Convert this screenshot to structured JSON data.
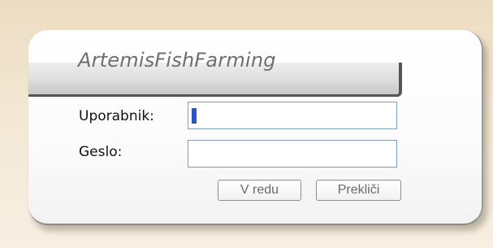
{
  "login": {
    "title": "ArtemisFishFarming",
    "username_label": "Uporabnik:",
    "username_value": "",
    "password_label": "Geslo:",
    "password_value": "",
    "ok_label": "V redu",
    "cancel_label": "Prekliči"
  },
  "colors": {
    "background": "#ecdcc1",
    "panel": "#ffffff",
    "input_border": "#7f9db9",
    "caret": "#2855c8",
    "title_text": "#6e6e6e"
  }
}
